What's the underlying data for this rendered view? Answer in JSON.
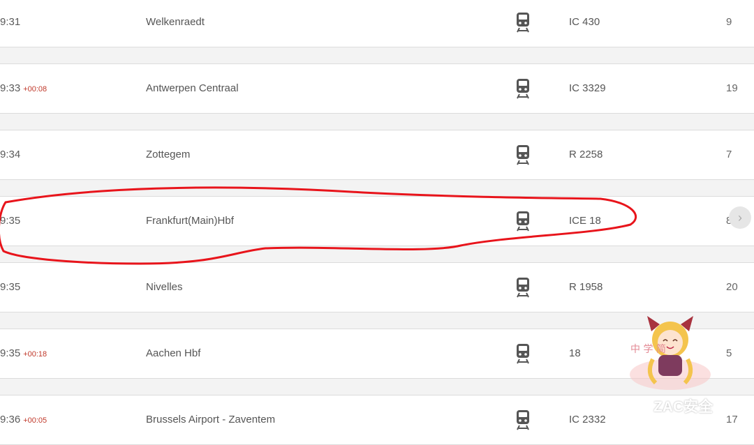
{
  "departures": [
    {
      "time": "9:31",
      "delay": "",
      "destination": "Welkenraedt",
      "train": "IC 430",
      "platform": "9"
    },
    {
      "time": "9:33",
      "delay": "+00:08",
      "destination": "Antwerpen Centraal",
      "train": "IC 3329",
      "platform": "19"
    },
    {
      "time": "9:34",
      "delay": "",
      "destination": "Zottegem",
      "train": "R 2258",
      "platform": "7"
    },
    {
      "time": "9:35",
      "delay": "",
      "destination": "Frankfurt(Main)Hbf",
      "train": "ICE 18",
      "platform": "8"
    },
    {
      "time": "9:35",
      "delay": "",
      "destination": "Nivelles",
      "train": "R 1958",
      "platform": "20"
    },
    {
      "time": "9:35",
      "delay": "+00:18",
      "destination": "Aachen Hbf",
      "train": "18",
      "platform": "5"
    },
    {
      "time": "9:36",
      "delay": "+00:05",
      "destination": "Brussels Airport - Zaventem",
      "train": "IC 2332",
      "platform": "17"
    }
  ],
  "icons": {
    "row_icon": "train-icon",
    "next_button": "chevron-right-icon",
    "watermark": "wechat-icon"
  },
  "colors": {
    "delay": "#c0392b",
    "annotation": "#e8141b",
    "row_bg": "#ffffff",
    "page_bg": "#f3f3f3"
  },
  "watermark": {
    "text": "ZAC安全",
    "mascot_text": "中 学 简"
  }
}
